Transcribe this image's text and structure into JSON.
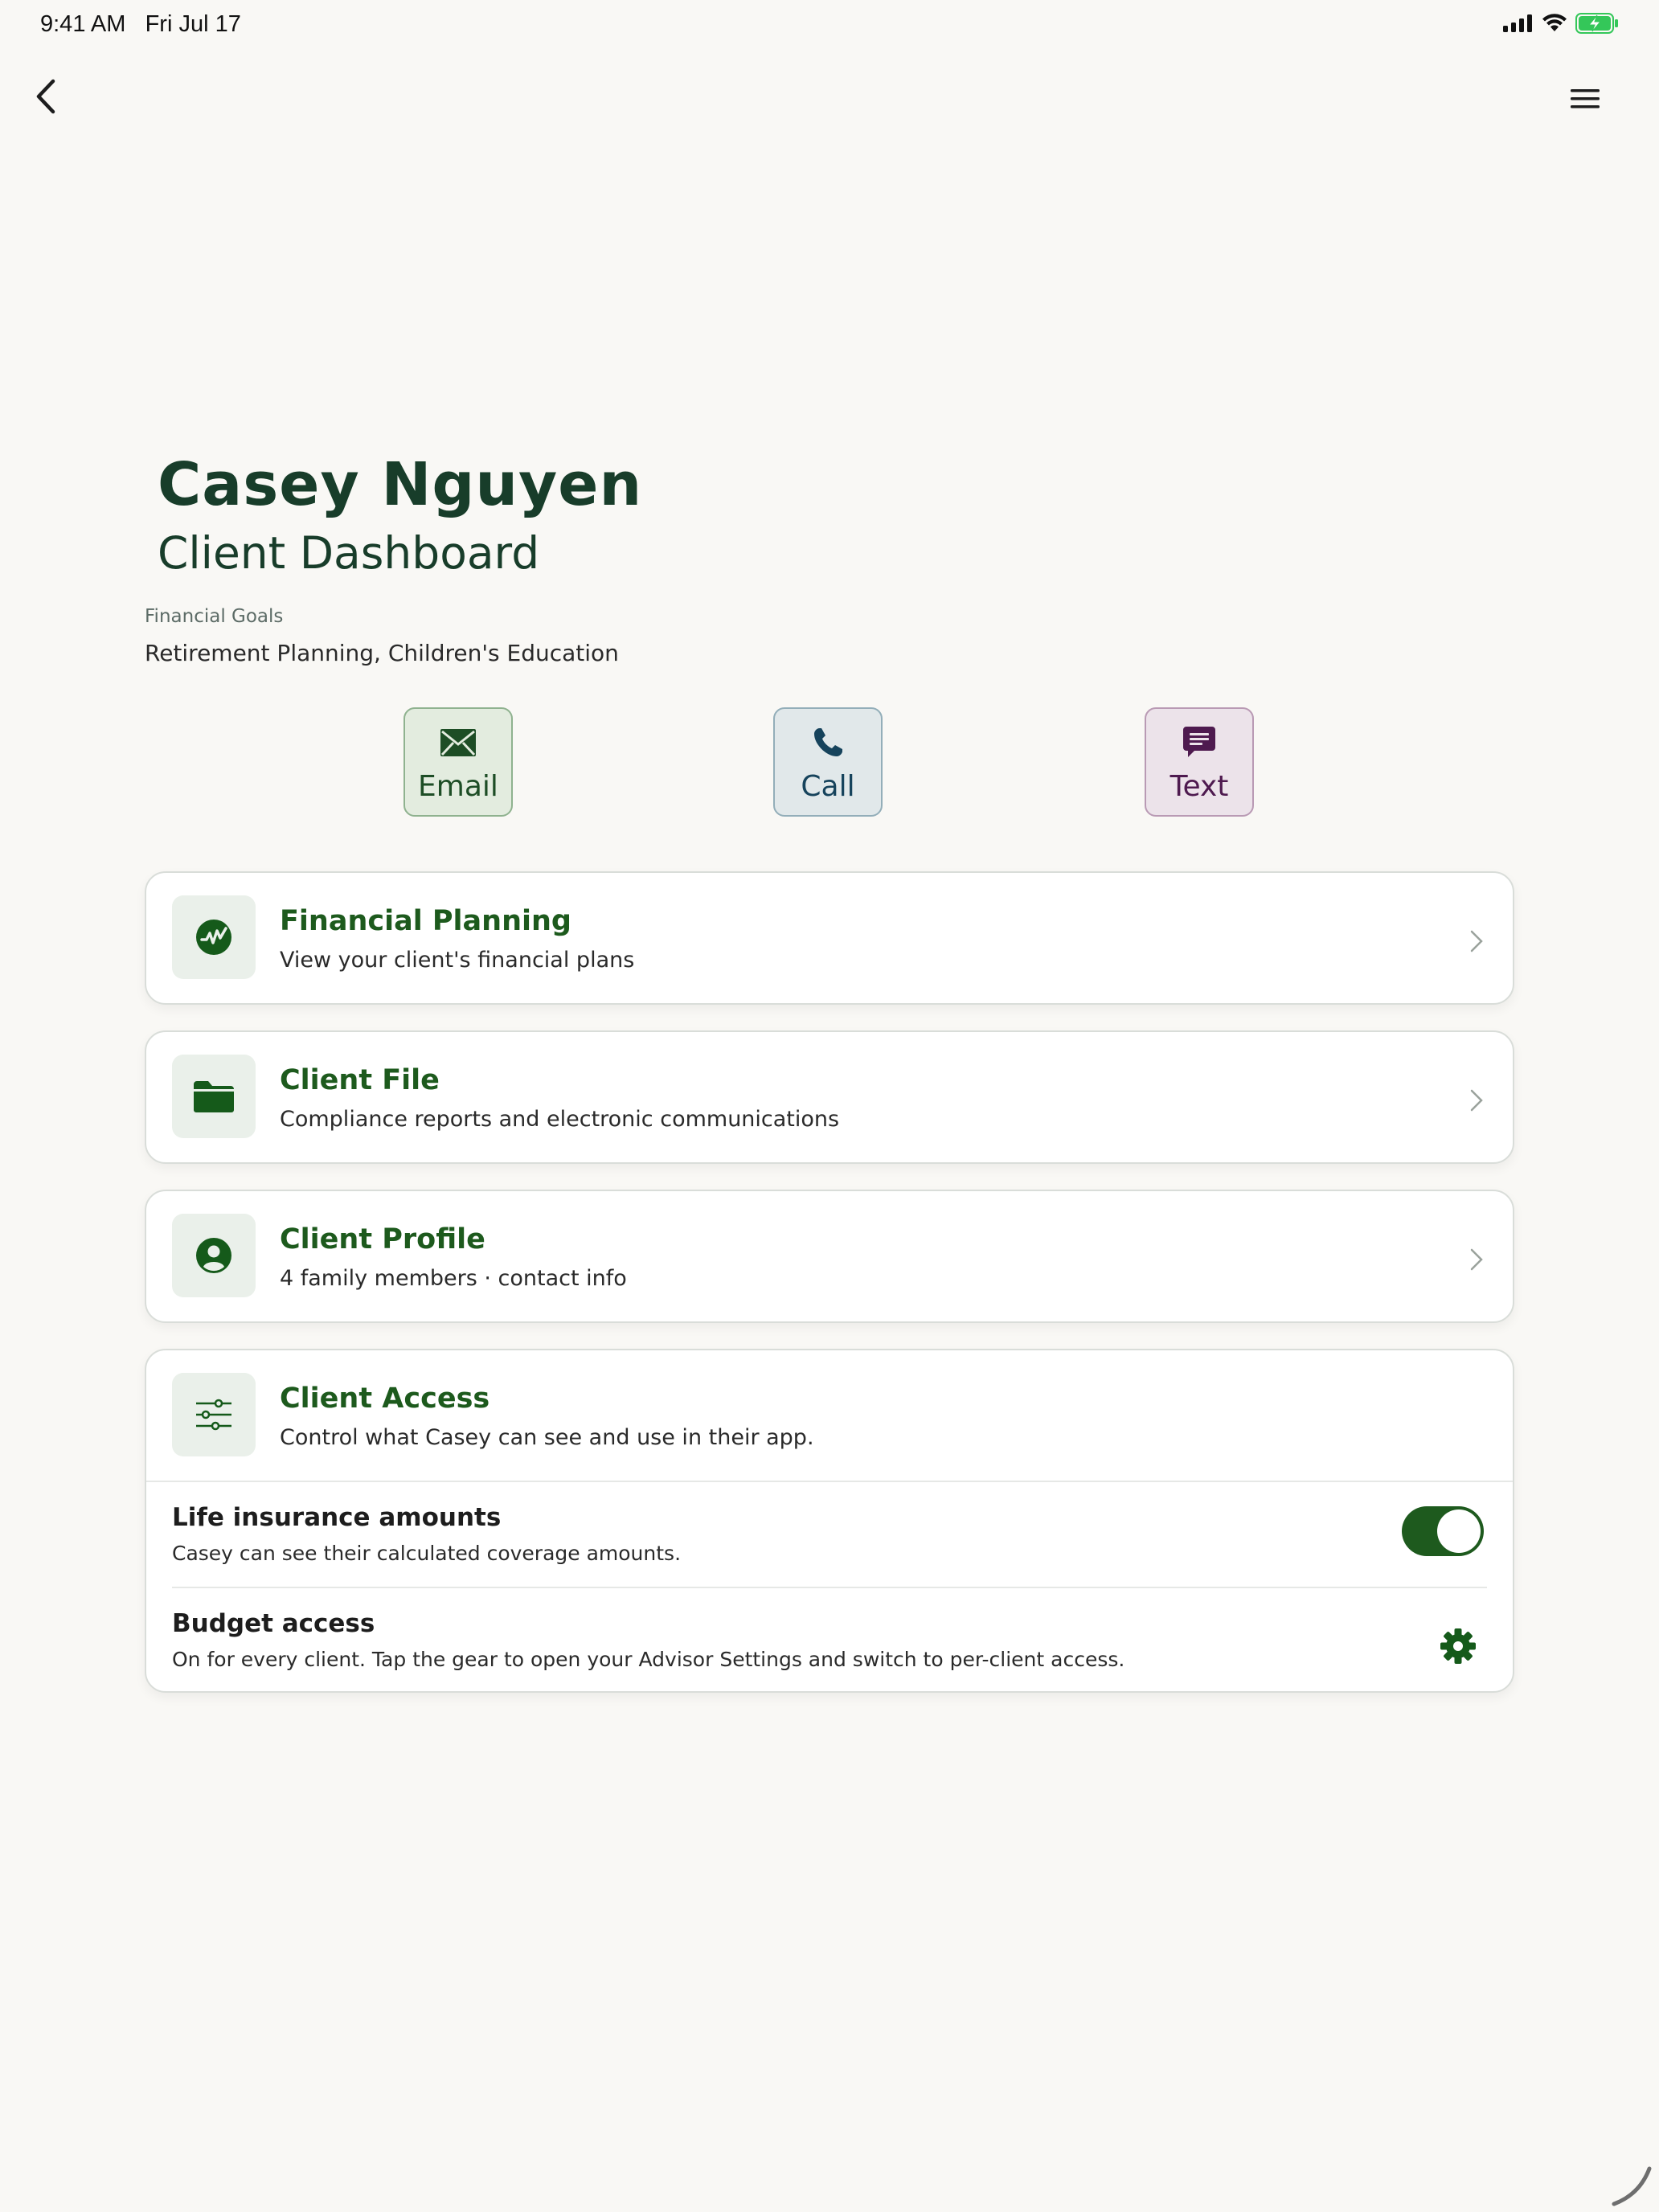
{
  "status_bar": {
    "time": "9:41 AM",
    "date": "Fri Jul 17"
  },
  "nav": {
    "back_icon": "chevron-left-icon",
    "menu_icon": "hamburger-menu-icon"
  },
  "header": {
    "client_name": "Casey Nguyen",
    "subtitle": "Client Dashboard",
    "goals_label": "Financial Goals",
    "goals_value": "Retirement Planning, Children's Education"
  },
  "contact_actions": [
    {
      "label": "Email",
      "icon": "envelope-icon",
      "color": "#1d4d25"
    },
    {
      "label": "Call",
      "icon": "phone-icon",
      "color": "#16435c"
    },
    {
      "label": "Text",
      "icon": "chat-bubble-icon",
      "color": "#4e1a4f"
    }
  ],
  "cards": [
    {
      "title": "Financial Planning",
      "description": "View your client's financial plans",
      "icon": "chart-circle-icon"
    },
    {
      "title": "Client File",
      "description": "Compliance reports and electronic communications",
      "icon": "folder-icon"
    },
    {
      "title": "Client Profile",
      "description": "4 family members · contact info",
      "icon": "person-circle-icon"
    }
  ],
  "client_access": {
    "title": "Client Access",
    "description": "Control what Casey can see and use in their app.",
    "icon": "sliders-icon",
    "settings": [
      {
        "title": "Life insurance amounts",
        "description": "Casey can see their calculated coverage amounts.",
        "control": "toggle",
        "enabled": true
      },
      {
        "title": "Budget access",
        "description": "On for every client. Tap the gear to open your Advisor Settings and switch to per-client access.",
        "control": "gear-icon"
      }
    ]
  },
  "colors": {
    "accent_green": "#1d5a1d",
    "heading": "#183d2a",
    "background": "#f9f8f5"
  }
}
